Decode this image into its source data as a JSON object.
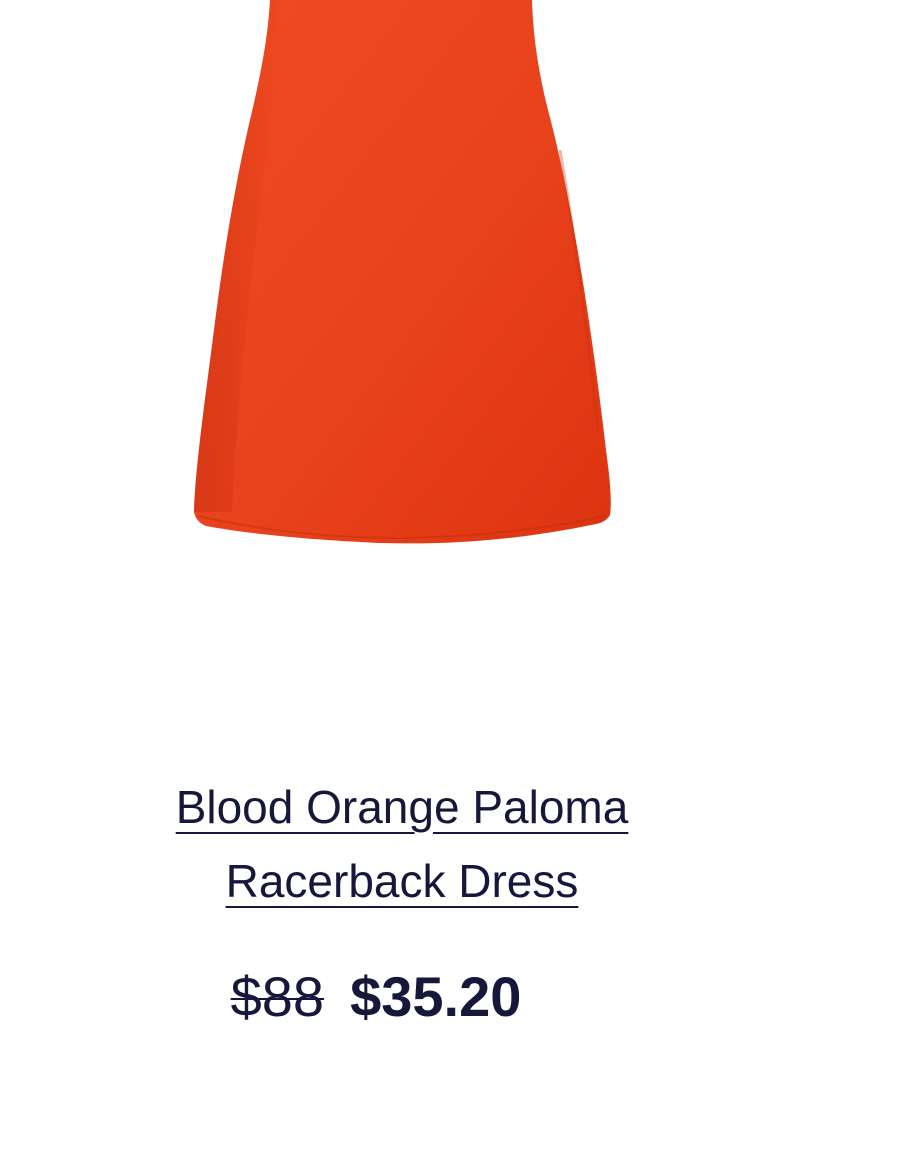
{
  "product": {
    "name": "Blood Orange Paloma Racerback Dress",
    "color_name": "Blood Orange",
    "image_color": "#e8421c",
    "price": {
      "original": "$88",
      "sale": "$35.20"
    }
  },
  "colors": {
    "text": "#15183a",
    "background": "#ffffff"
  }
}
